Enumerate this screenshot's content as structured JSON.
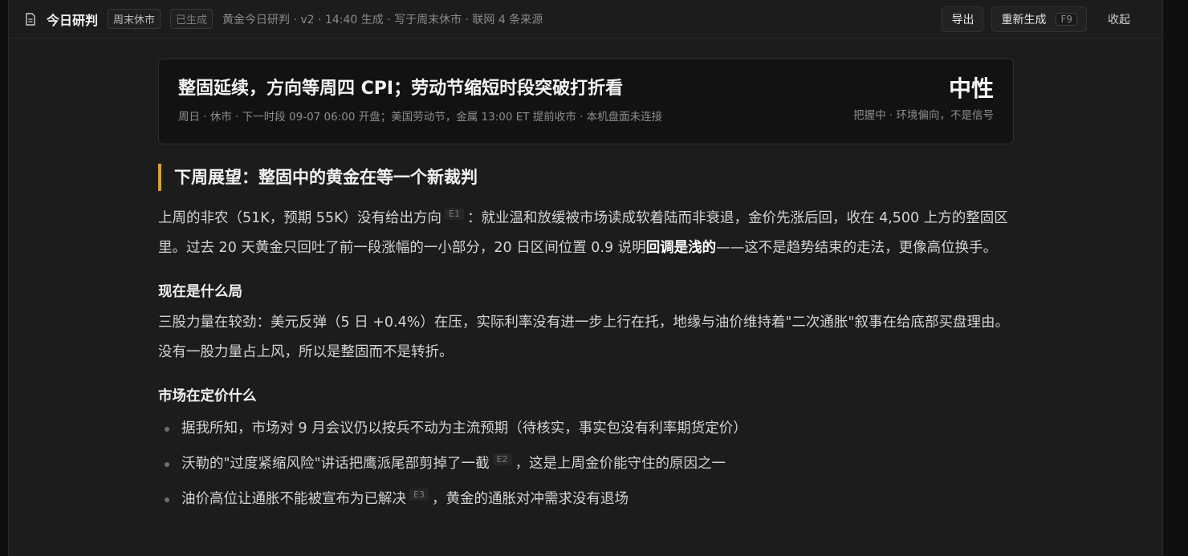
{
  "topbar": {
    "title": "今日研判",
    "tag_market": "周末休市",
    "tag_status": "已生成",
    "meta": "黄金今日研判 · v2 · 14:40 生成 · 写于周末休市 · 联网 4 条来源",
    "export_label": "导出",
    "regenerate_label": "重新生成",
    "regenerate_shortcut": "F9",
    "collapse_label": "收起"
  },
  "summary": {
    "headline": "整固延续，方向等周四 CPI；劳动节缩短时段突破打折看",
    "subline": "周日 · 休市 · 下一时段 09-07 06:00 开盘；美国劳动节，金属 13:00 ET 提前收市 · 本机盘面未连接",
    "verdict": "中性",
    "verdict_note": "把握中 · 环境偏向，不是信号"
  },
  "outlook": {
    "title": "下周展望：整固中的黄金在等一个新裁判",
    "p1_a": "上周的非农（51K，预期 55K）没有给出方向",
    "p1_cite": "E1",
    "p1_b": "：就业温和放缓被市场读成软着陆而非衰退，金价先涨后回，收在 4,500 上方的整固区里。过去 20 天黄金只回吐了前一段涨幅的一小部分，20 日区间位置 0.9 说明",
    "p1_bold": "回调是浅的",
    "p1_c": "——这不是趋势结束的走法，更像高位换手。"
  },
  "situation": {
    "heading": "现在是什么局",
    "text": "三股力量在较劲：美元反弹（5 日 +0.4%）在压，实际利率没有进一步上行在托，地缘与油价维持着\"二次通胀\"叙事在给底部买盘理由。没有一股力量占上风，所以是整固而不是转折。"
  },
  "pricing": {
    "heading": "市场在定价什么",
    "items": [
      {
        "a": "据我所知，市场对 9 月会议仍以按兵不动为主流预期（待核实，事实包没有利率期货定价）",
        "cite": "",
        "b": ""
      },
      {
        "a": "沃勒的\"过度紧缩风险\"讲话把鹰派尾部剪掉了一截",
        "cite": "E2",
        "b": "，这是上周金价能守住的原因之一"
      },
      {
        "a": "油价高位让通胀不能被宣布为已解决",
        "cite": "E3",
        "b": "，黄金的通胀对冲需求没有退场"
      }
    ]
  }
}
